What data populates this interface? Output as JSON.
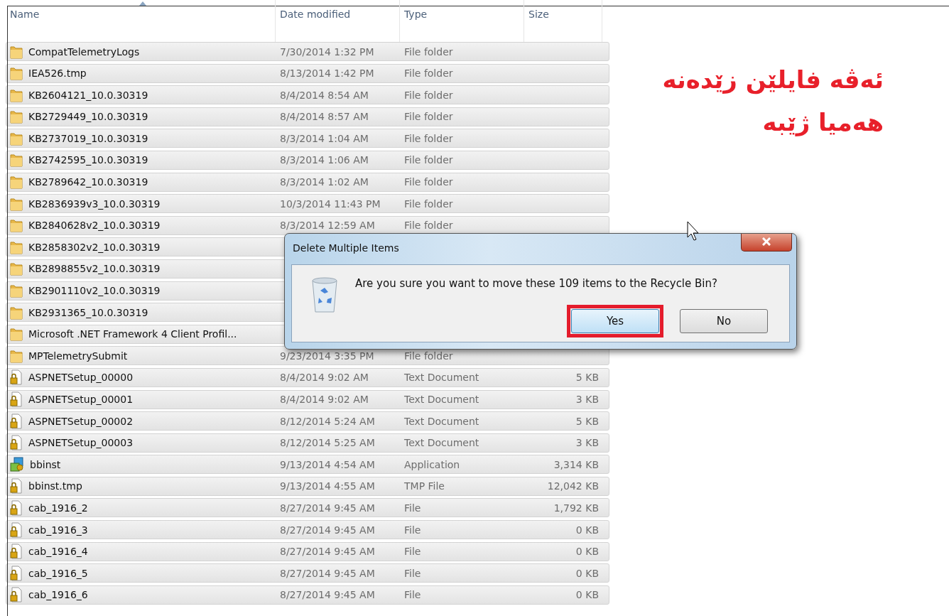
{
  "columns": [
    {
      "label": "Name",
      "sorted": true
    },
    {
      "label": "Date modified",
      "sorted": false
    },
    {
      "label": "Type",
      "sorted": false
    },
    {
      "label": "Size",
      "sorted": false
    }
  ],
  "rows": [
    {
      "kind": "folder",
      "name": "CompatTelemetryLogs",
      "date": "7/30/2014 1:32 PM",
      "type": "File folder",
      "selected": true
    },
    {
      "kind": "folder",
      "name": "IEA526.tmp",
      "date": "8/13/2014 1:42 PM",
      "type": "File folder",
      "selected": true
    },
    {
      "kind": "folder",
      "name": "KB2604121_10.0.30319",
      "date": "8/4/2014 8:54 AM",
      "type": "File folder",
      "selected": true
    },
    {
      "kind": "folder",
      "name": "KB2729449_10.0.30319",
      "date": "8/4/2014 8:57 AM",
      "type": "File folder",
      "selected": true
    },
    {
      "kind": "folder",
      "name": "KB2737019_10.0.30319",
      "date": "8/3/2014 1:04 AM",
      "type": "File folder",
      "selected": true
    },
    {
      "kind": "folder",
      "name": "KB2742595_10.0.30319",
      "date": "8/3/2014 1:06 AM",
      "type": "File folder",
      "selected": true
    },
    {
      "kind": "folder",
      "name": "KB2789642_10.0.30319",
      "date": "8/3/2014 1:02 AM",
      "type": "File folder",
      "selected": true
    },
    {
      "kind": "folder",
      "name": "KB2836939v3_10.0.30319",
      "date": "10/3/2014 11:43 PM",
      "type": "File folder",
      "selected": true
    },
    {
      "kind": "folder",
      "name": "KB2840628v2_10.0.30319",
      "date": "8/3/2014 12:59 AM",
      "type": "File folder",
      "selected": true
    },
    {
      "kind": "folder",
      "name": "KB2858302v2_10.0.30319",
      "selected": true
    },
    {
      "kind": "folder",
      "name": "KB2898855v2_10.0.30319",
      "selected": true
    },
    {
      "kind": "folder",
      "name": "KB2901110v2_10.0.30319",
      "selected": true
    },
    {
      "kind": "folder",
      "name": "KB2931365_10.0.30319",
      "selected": true
    },
    {
      "kind": "folder",
      "name": "Microsoft .NET Framework 4 Client Profil...",
      "selected": true
    },
    {
      "kind": "folder",
      "name": "MPTelemetrySubmit",
      "date": "9/23/2014 3:35 PM",
      "type": "File folder",
      "selected": true
    },
    {
      "kind": "locked-file",
      "name": "ASPNETSetup_00000",
      "date": "8/4/2014 9:02 AM",
      "type": "Text Document",
      "size": "5 KB",
      "selected": true
    },
    {
      "kind": "locked-file",
      "name": "ASPNETSetup_00001",
      "date": "8/4/2014 9:02 AM",
      "type": "Text Document",
      "size": "3 KB",
      "selected": true
    },
    {
      "kind": "locked-file",
      "name": "ASPNETSetup_00002",
      "date": "8/12/2014 5:24 AM",
      "type": "Text Document",
      "size": "5 KB",
      "selected": true
    },
    {
      "kind": "locked-file",
      "name": "ASPNETSetup_00003",
      "date": "8/12/2014 5:25 AM",
      "type": "Text Document",
      "size": "3 KB",
      "selected": true
    },
    {
      "kind": "app",
      "name": "bbinst",
      "date": "9/13/2014 4:54 AM",
      "type": "Application",
      "size": "3,314 KB",
      "selected": true
    },
    {
      "kind": "locked-file",
      "name": "bbinst.tmp",
      "date": "9/13/2014 4:55 AM",
      "type": "TMP File",
      "size": "12,042 KB",
      "selected": true
    },
    {
      "kind": "locked-file",
      "name": "cab_1916_2",
      "date": "8/27/2014 9:45 AM",
      "type": "File",
      "size": "1,792 KB",
      "selected": true
    },
    {
      "kind": "locked-file",
      "name": "cab_1916_3",
      "date": "8/27/2014 9:45 AM",
      "type": "File",
      "size": "0 KB",
      "selected": true
    },
    {
      "kind": "locked-file",
      "name": "cab_1916_4",
      "date": "8/27/2014 9:45 AM",
      "type": "File",
      "size": "0 KB",
      "selected": true
    },
    {
      "kind": "locked-file",
      "name": "cab_1916_5",
      "date": "8/27/2014 9:45 AM",
      "type": "File",
      "size": "0 KB",
      "selected": true
    },
    {
      "kind": "locked-file",
      "name": "cab_1916_6",
      "date": "8/27/2014 9:45 AM",
      "type": "File",
      "size": "0 KB",
      "selected": true
    }
  ],
  "annotation": {
    "lines": [
      "ئەڤە فایلێن زێدەنە",
      "هەمیا ژێبە"
    ]
  },
  "dialog": {
    "title": "Delete Multiple Items",
    "message": "Are you sure you want to move these 109 items to the Recycle Bin?",
    "buttons": [
      {
        "label": "Yes",
        "highlighted": true
      },
      {
        "label": "No",
        "highlighted": false
      }
    ]
  }
}
